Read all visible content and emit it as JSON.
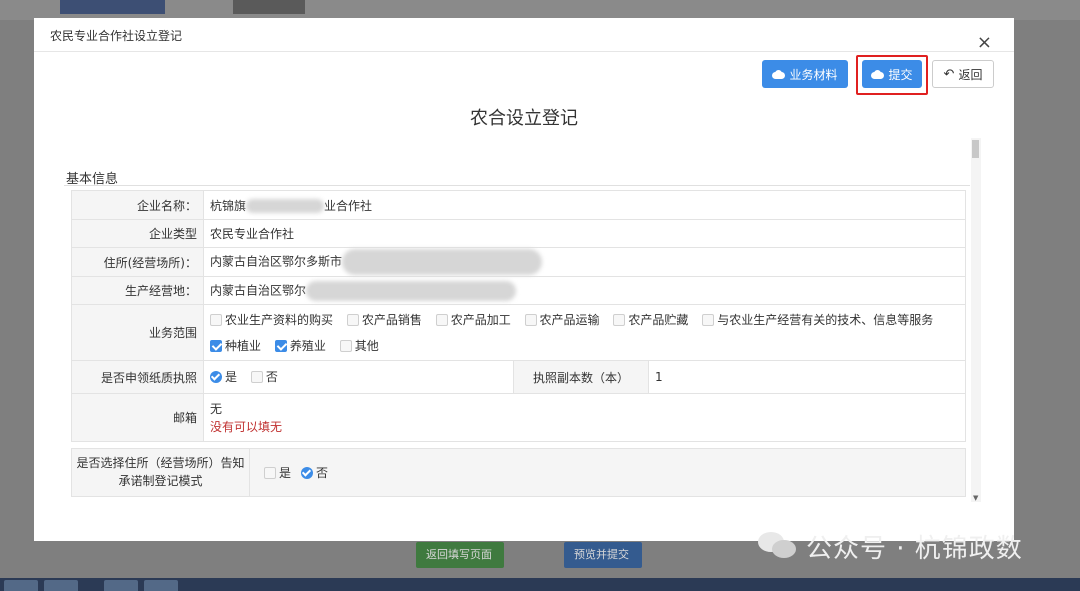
{
  "modal": {
    "title": "农民专业合作社设立登记",
    "close_glyph": "×"
  },
  "toolbar": {
    "materials_label": "业务材料",
    "submit_label": "提交",
    "back_label": "返回",
    "back_glyph": "↶"
  },
  "form_title": "农合设立登记",
  "section": {
    "label": "基本信息"
  },
  "fields": {
    "company_name": {
      "label": "企业名称：",
      "value": "杭锦旗",
      "value_tail": "业合作社"
    },
    "company_type": {
      "label": "企业类型",
      "value": "农民专业合作社"
    },
    "address": {
      "label": "住所(经营场所)：",
      "value": "内蒙古自治区鄂尔多斯市"
    },
    "production_site": {
      "label": "生产经营地：",
      "value": "内蒙古自治区鄂尔"
    },
    "business_scope": {
      "label": "业务范围",
      "options": [
        {
          "label": "农业生产资料的购买",
          "checked": false
        },
        {
          "label": "农产品销售",
          "checked": false
        },
        {
          "label": "农产品加工",
          "checked": false
        },
        {
          "label": "农产品运输",
          "checked": false
        },
        {
          "label": "农产品贮藏",
          "checked": false
        },
        {
          "label": "与农业生产经营有关的技术、信息等服务",
          "checked": false
        },
        {
          "label": "种植业",
          "checked": true
        },
        {
          "label": "养殖业",
          "checked": true
        },
        {
          "label": "其他",
          "checked": false
        }
      ]
    },
    "paper_license": {
      "label": "是否申领纸质执照",
      "yes": "是",
      "no": "否",
      "selected": "是"
    },
    "license_copies": {
      "label": "执照副本数（本）",
      "value": "1"
    },
    "email": {
      "label": "邮箱",
      "value": "无",
      "hint": "没有可以填无"
    },
    "notice_mode": {
      "label": "是否选择住所（经营场所）告知承诺制登记模式",
      "yes": "是",
      "no": "否",
      "selected": "否"
    }
  },
  "background": {
    "return_button": "返回填写页面",
    "preview_button": "预览并提交"
  },
  "watermark": "公众号 · 杭锦政数",
  "colors": {
    "primary": "#3c8ce7",
    "highlight": "#e02020",
    "hint": "#c0302f"
  }
}
